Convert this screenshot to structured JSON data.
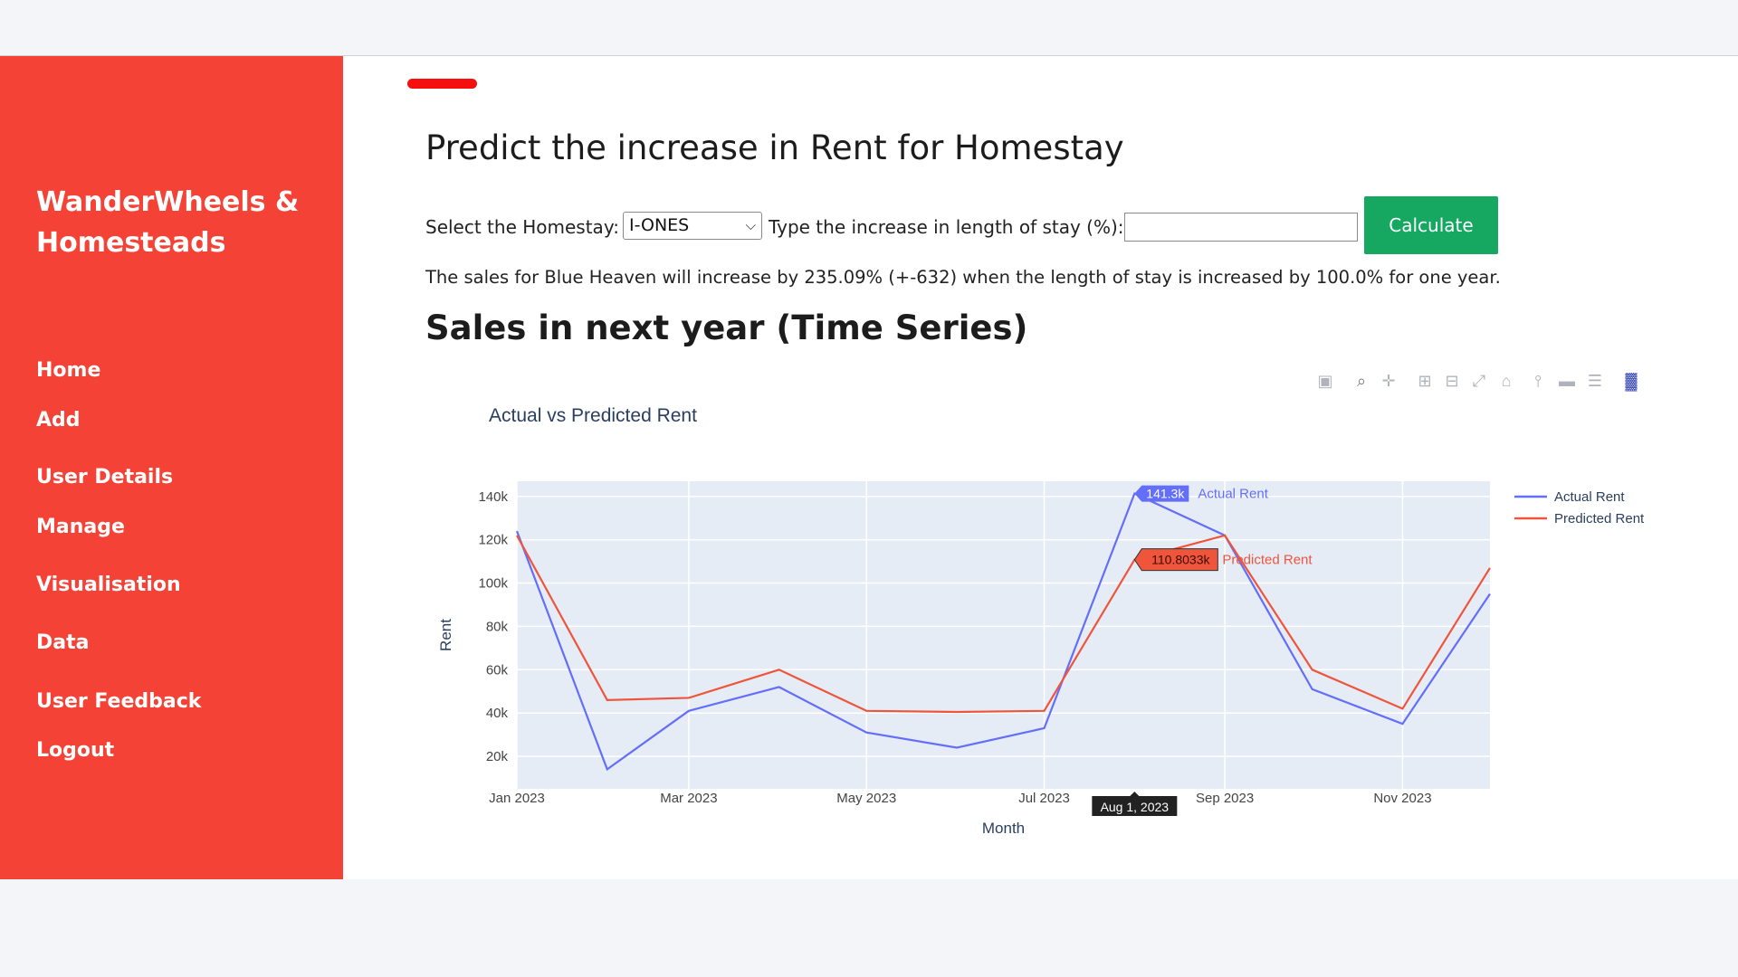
{
  "sidebar": {
    "brand": "WanderWheels & Homesteads",
    "items": [
      {
        "label": "Home"
      },
      {
        "label": "Add"
      },
      {
        "label": "User Details"
      },
      {
        "label": "Manage"
      },
      {
        "label": "Visualisation"
      },
      {
        "label": "Data"
      },
      {
        "label": "User Feedback"
      },
      {
        "label": "Logout"
      }
    ]
  },
  "main": {
    "title": "Predict the increase in Rent for Homestay",
    "form": {
      "homestay_label": "Select the Homestay:",
      "homestay_value": "I-ONES",
      "increase_label": "Type the increase in length of stay (%):",
      "increase_value": "",
      "calculate_label": "Calculate"
    },
    "result": "The sales for Blue Heaven will increase by 235.09% (+-632) when the length of stay is increased by 100.0% for one year.",
    "section_title": "Sales in next year (Time Series)"
  },
  "modebar": {
    "icons": [
      "camera-icon",
      "zoom-icon",
      "pan-icon",
      "zoom-in-icon",
      "zoom-out-icon",
      "autoscale-icon",
      "reset-axes-icon",
      "spike-lines-icon",
      "hover-closest-icon",
      "hover-compare-icon",
      "plotly-logo-icon"
    ]
  },
  "colors": {
    "sidebar": "#f44336",
    "calculate": "#16a761",
    "actual": "#636efa",
    "predicted": "#ef553b",
    "plot_bg": "#e5ecf6"
  },
  "chart_data": {
    "type": "line",
    "title": "Actual vs Predicted Rent",
    "xlabel": "Month",
    "ylabel": "Rent",
    "x": [
      "2023-01-01",
      "2023-02-01",
      "2023-03-01",
      "2023-04-01",
      "2023-05-01",
      "2023-06-01",
      "2023-07-01",
      "2023-08-01",
      "2023-09-01",
      "2023-10-01",
      "2023-11-01",
      "2023-12-01"
    ],
    "x_tick_labels": [
      "Jan 2023",
      "Mar 2023",
      "May 2023",
      "Jul 2023",
      "Sep 2023",
      "Nov 2023"
    ],
    "y_ticks": [
      20000,
      40000,
      60000,
      80000,
      100000,
      120000,
      140000
    ],
    "y_tick_labels": [
      "20k",
      "40k",
      "60k",
      "80k",
      "100k",
      "120k",
      "140k"
    ],
    "ylim": [
      5000,
      147000
    ],
    "series": [
      {
        "name": "Actual Rent",
        "color": "#636efa",
        "values": [
          124000,
          14000,
          41000,
          52000,
          31000,
          24000,
          33000,
          141300,
          122000,
          51000,
          35000,
          95000
        ]
      },
      {
        "name": "Predicted Rent",
        "color": "#ef553b",
        "values": [
          122000,
          46000,
          47000,
          60000,
          41000,
          40500,
          41000,
          110803.3,
          122000,
          60000,
          42000,
          107000
        ]
      }
    ],
    "legend_position": "right",
    "grid": true,
    "hover": {
      "x_label": "Aug 1, 2023",
      "labels": [
        {
          "series": "Actual Rent",
          "value": "141.3k"
        },
        {
          "series": "Predicted Rent",
          "value": "110.8033k"
        }
      ]
    }
  }
}
